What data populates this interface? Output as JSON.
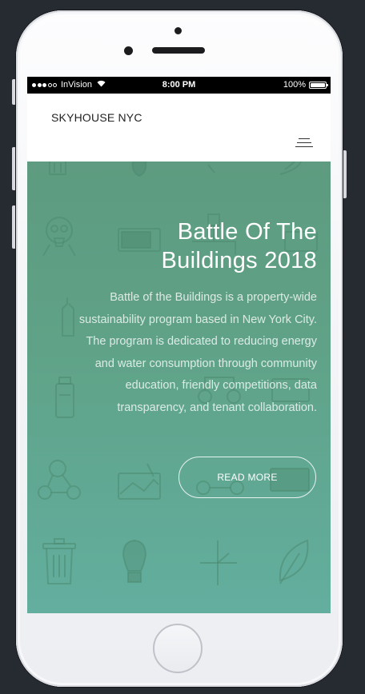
{
  "status_bar": {
    "carrier": "InVision",
    "time": "8:00 PM",
    "battery": "100%"
  },
  "navbar": {
    "brand": "SKYHOUSE NYC",
    "menu_icon": "hamburger-menu-icon"
  },
  "hero": {
    "title_line1": "Battle Of The",
    "title_line2": "Buildings 2018",
    "text_lines": [
      "Battle of the Buildings is a property-wide",
      "sustainability program based in New York City.",
      "The program is dedicated to reducing energy",
      "and water consumption through community",
      "education, friendly competitions, data",
      "transparency, and tenant collaboration."
    ],
    "cta_label": "READ MORE",
    "background_icons": [
      "trash-can-icon",
      "lightbulb-icon",
      "clock-icon",
      "leaf-icon",
      "gas-mask-icon",
      "battery-icon",
      "pipes-icon",
      "water-bottle-icon",
      "molecule-icon",
      "landscape-icon"
    ]
  },
  "colors": {
    "hero_top": "#5e9b80",
    "hero_bottom": "#63ae9f",
    "navbar_bg": "#ffffff",
    "page_bg": "#262a31"
  }
}
